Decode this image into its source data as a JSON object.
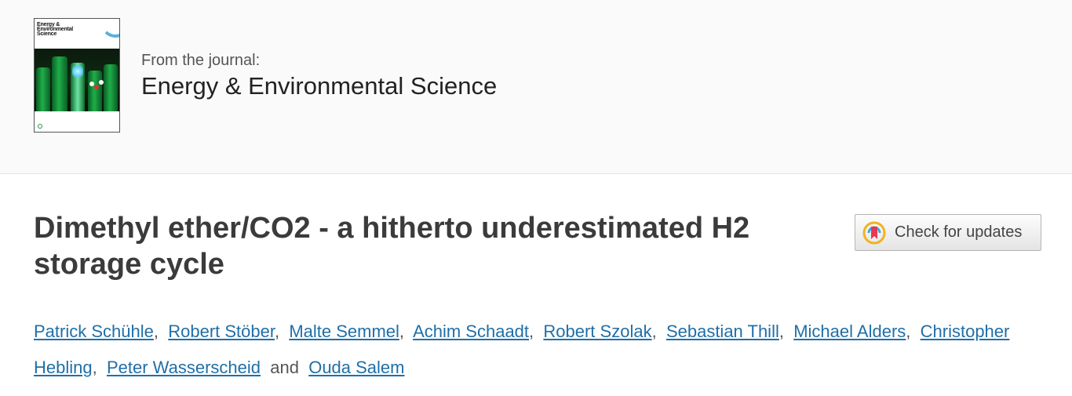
{
  "journal": {
    "cover_title_lines": [
      "Energy &",
      "Environmental",
      "Science"
    ],
    "from_label": "From the journal:",
    "name": "Energy & Environmental Science"
  },
  "article": {
    "title_line1": "Dimethyl ether/CO2 - a hitherto underestimated H2",
    "title_line2": "storage cycle"
  },
  "check_updates": {
    "label": "Check for updates",
    "icon": "crossmark-icon"
  },
  "authors": {
    "names": [
      "Patrick Schühle",
      "Robert Stöber",
      "Malte Semmel",
      "Achim Schaadt",
      "Robert Szolak",
      "Sebastian Thill",
      "Michael Alders",
      "Christopher Hebling",
      "Peter Wasserscheid",
      "Ouda Salem"
    ],
    "separator": ",",
    "conjunction": "and"
  },
  "colors": {
    "link": "#1f6fa8",
    "title": "#3b3b3b"
  }
}
